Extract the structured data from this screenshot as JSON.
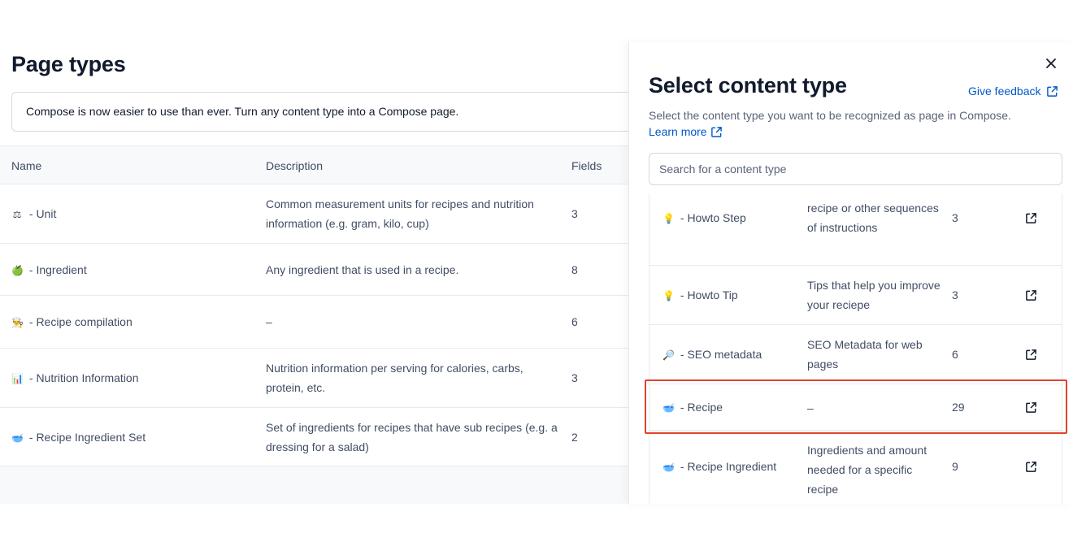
{
  "page": {
    "title": "Page types",
    "notice": "Compose is now easier to use than ever. Turn any content type into a Compose page.",
    "columns": {
      "name": "Name",
      "description": "Description",
      "fields": "Fields"
    },
    "rows": [
      {
        "icon": "⚖",
        "icon_name": "scale-icon",
        "name": " - Unit",
        "description": "Common measurement units for recipes and nutrition information (e.g. gram, kilo, cup)",
        "fields": "3"
      },
      {
        "icon": "🍏",
        "icon_name": "apple-icon",
        "name": " - Ingredient",
        "description": "Any ingredient that is used in a recipe.",
        "fields": "8"
      },
      {
        "icon": "👨‍🍳",
        "icon_name": "chef-icon",
        "name": " - Recipe compilation",
        "description": "–",
        "fields": "6"
      },
      {
        "icon": "📊",
        "icon_name": "bar-chart-icon",
        "name": " - Nutrition Information",
        "description": "Nutrition information per serving for calories, carbs, protein, etc.",
        "fields": "3"
      },
      {
        "icon": "🥣",
        "icon_name": "bowl-icon",
        "name": " - Recipe Ingredient Set",
        "description": "Set of ingredients for recipes that have sub recipes (e.g. a dressing for a salad)",
        "fields": "2"
      }
    ]
  },
  "panel": {
    "title": "Select content type",
    "feedback_label": "Give feedback",
    "description": "Select the content type you want to be recognized as page in Compose.",
    "learn_more": "Learn more",
    "search_placeholder": "Search for a content type",
    "items": [
      {
        "icon": "💡",
        "icon_name": "lightbulb-icon",
        "name": " - Howto Step",
        "description": "recipe or other sequences of instructions",
        "fields": "3"
      },
      {
        "icon": "💡",
        "icon_name": "lightbulb-icon",
        "name": " - Howto Tip",
        "description": "Tips that help you improve your reciepe",
        "fields": "3"
      },
      {
        "icon": "🔎",
        "icon_name": "magnifier-icon",
        "name": " - SEO metadata",
        "description": "SEO Metadata for web pages",
        "fields": "6"
      },
      {
        "icon": "🥣",
        "icon_name": "bowl-icon",
        "name": " - Recipe",
        "description": "–",
        "fields": "29"
      },
      {
        "icon": "🥣",
        "icon_name": "bowl-icon",
        "name": " - Recipe Ingredient",
        "description": "Ingredients and amount needed for a specific recipe",
        "fields": "9"
      }
    ]
  },
  "colors": {
    "link": "#0059c8",
    "highlight": "#e0432e",
    "text": "#111b2b",
    "muted": "#414d63"
  }
}
